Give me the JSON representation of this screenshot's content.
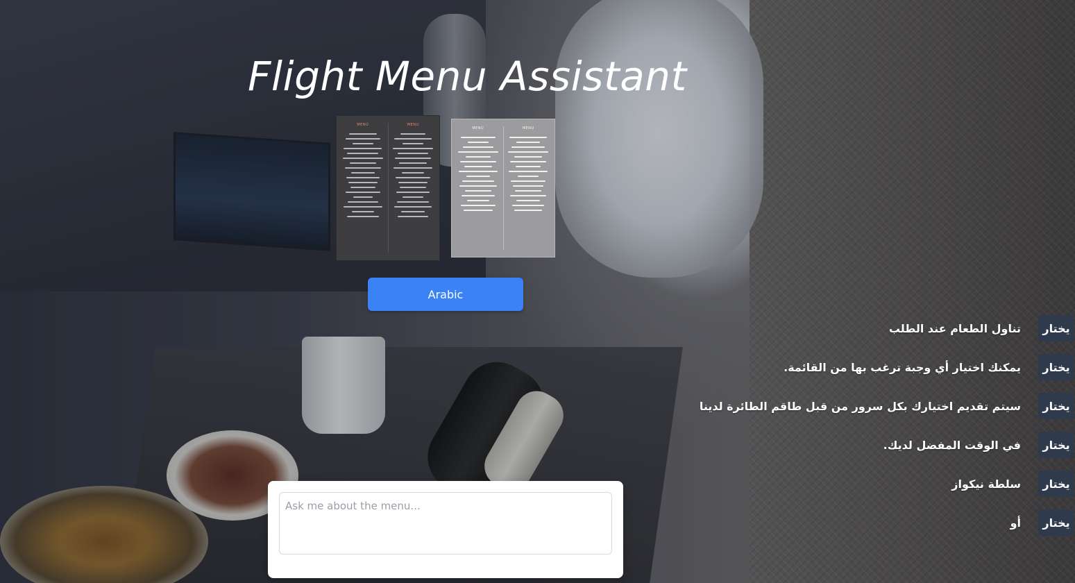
{
  "app": {
    "title": "Flight Menu Assistant"
  },
  "menu_images": {
    "dark": {
      "headings": [
        "MENÚ",
        "MENU"
      ]
    },
    "light": {
      "headings": [
        "MENÚ",
        "MENU"
      ]
    }
  },
  "language_button": {
    "label": "Arabic"
  },
  "menu_items": [
    {
      "text": "تناول الطعام عند الطلب",
      "button": "يختار"
    },
    {
      "text": "يمكنك اختيار أي وجبة ترغب بها من القائمة.",
      "button": "يختار"
    },
    {
      "text": "سيتم تقديم اختيارك بكل سرور من قبل طاقم الطائرة لدينا",
      "button": "يختار"
    },
    {
      "text": "في الوقت المفضل لديك.",
      "button": "يختار"
    },
    {
      "text": "سلطة نيكواز",
      "button": "يختار"
    },
    {
      "text": "أو",
      "button": "يختار"
    }
  ],
  "chat": {
    "placeholder": "Ask me about the menu..."
  },
  "colors": {
    "accent": "#3b82f6",
    "choose_button_bg": "#2f3a4d",
    "text": "#ffffff"
  }
}
